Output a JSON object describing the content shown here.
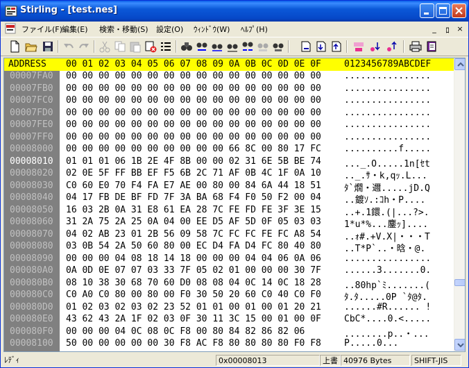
{
  "window": {
    "title": "Stirling - [test.nes]",
    "controls": {
      "minimize": "minimize",
      "maximize": "maximize",
      "close": "close"
    }
  },
  "menubar": {
    "items": [
      "ファイル(F)",
      "編集(E)",
      "検索・移動(S)",
      "設定(O)",
      "ｳｨﾝﾄﾞｳ(W)",
      "ﾍﾙﾌﾟ(H)"
    ],
    "mdi": [
      "_",
      "ﾛ",
      "×"
    ]
  },
  "toolbar": {
    "icons": [
      "new-file-icon",
      "open-folder-icon",
      "save-icon",
      "undo-icon",
      "redo-icon",
      "cut-icon",
      "copy-icon",
      "paste-icon",
      "delete-icon",
      "insert-list-icon",
      "find-icon",
      "find-next-icon",
      "find-prev-icon",
      "find-all-icon",
      "replace-icon",
      "jump-icon",
      "goto-icon",
      "bookmark-set-icon",
      "bookmark-next-icon",
      "bookmark-prev-icon",
      "mark-icon",
      "mark-next-icon",
      "mark-prev-icon",
      "print-icon",
      "print-preview-icon"
    ]
  },
  "editor": {
    "header": {
      "address": "ADDRESS",
      "columns": "00 01 02 03 04 05 06 07 08 09 0A 0B 0C 0D 0E 0F",
      "ascii": "0123456789ABCDEF"
    },
    "rows": [
      {
        "addr": "00007FA0",
        "hex": "00 00 00 00 00 00 00 00 00 00 00 00 00 00 00 00",
        "ascii": "................"
      },
      {
        "addr": "00007FB0",
        "hex": "00 00 00 00 00 00 00 00 00 00 00 00 00 00 00 00",
        "ascii": "................"
      },
      {
        "addr": "00007FC0",
        "hex": "00 00 00 00 00 00 00 00 00 00 00 00 00 00 00 00",
        "ascii": "................"
      },
      {
        "addr": "00007FD0",
        "hex": "00 00 00 00 00 00 00 00 00 00 00 00 00 00 00 00",
        "ascii": "................"
      },
      {
        "addr": "00007FE0",
        "hex": "00 00 00 00 00 00 00 00 00 00 00 00 00 00 00 00",
        "ascii": "................"
      },
      {
        "addr": "00007FF0",
        "hex": "00 00 00 00 00 00 00 00 00 00 00 00 00 00 00 00",
        "ascii": "................"
      },
      {
        "addr": "00008000",
        "hex": "00 00 00 00 00 00 00 00 00 00 66 8C 00 80 17 FC",
        "ascii": "..........f....."
      },
      {
        "addr": "00008010",
        "hex": "01 01 01 06 1B 2E 4F 8B 00 00 02 31 6E 5B BE 74",
        "ascii": "..._.O.....1n[ｾt"
      },
      {
        "addr": "00008020",
        "hex": "02 0E 5F FF BB EF F5 6B 2C 71 AF 0B 4C 1F 0A 10",
        "ascii": ".._.ｻ・k,qｯ.L..."
      },
      {
        "addr": "00008030",
        "hex": "C0 60 E0 70 F4 FA E7 AE 00 80 00 84 6A 44 18 51",
        "ascii": "ﾀ`燗・邇.....jD.Q"
      },
      {
        "addr": "00008040",
        "hex": "04 17 FB DE BF FD 7F 3A BA 68 F4 F0 50 F2 00 04",
        "ascii": "..鍍ｿ.:ｺh・P...."
      },
      {
        "addr": "00008050",
        "hex": "16 03 2B 0A 31 E8 61 EA 28 7C FE FD FE 3F 3E 15",
        "ascii": "..+.1鐶.(|...?>."
      },
      {
        "addr": "00008060",
        "hex": "31 2A 75 2A 25 0A 04 00 EE D5 AF 5D 0F 05 03 03",
        "ascii": "1*u*%...鏖ｯ]...."
      },
      {
        "addr": "00008070",
        "hex": "04 02 AB 23 01 2B 56 09 58 7C FC FC FE FC A8 54",
        "ascii": "..ｫ#.+V.X|・・・T"
      },
      {
        "addr": "00008080",
        "hex": "03 0B 54 2A 50 60 80 00 EC D4 FA D4 FC 80 40 80",
        "ascii": "..T*P`..・晗・@."
      },
      {
        "addr": "00008090",
        "hex": "00 00 00 04 08 18 14 18 00 00 00 04 04 06 0A 06",
        "ascii": "................"
      },
      {
        "addr": "000080A0",
        "hex": "0A 0D 0E 07 07 03 33 7F 05 02 01 00 00 00 30 7F",
        "ascii": "......3.......0."
      },
      {
        "addr": "000080B0",
        "hex": "08 10 38 30 68 70 60 D0 08 08 04 0C 14 0C 18 28",
        "ascii": "..80hp`ﾐ.......("
      },
      {
        "addr": "000080C0",
        "hex": "C0 A0 C0 80 00 80 00 F0 30 50 20 60 C0 40 C0 F0",
        "ascii": "ﾀ.ﾀ.....0P `ﾀ@ﾀ."
      },
      {
        "addr": "000080D0",
        "hex": "01 02 03 02 03 02 23 52 01 01 00 01 00 01 20 21",
        "ascii": "......#R...... !"
      },
      {
        "addr": "000080E0",
        "hex": "43 62 43 2A 1F 02 03 0F 30 11 3C 15 00 01 00 0F",
        "ascii": "CbC*....0.<....."
      },
      {
        "addr": "000080F0",
        "hex": "00 00 00 04 0C 08 0C F8 00 80 84 82 86 82 06",
        "ascii": "........p..・..."
      },
      {
        "addr": "00008100",
        "hex": "50 00 00 00 00 00 30 F8 AC F8 80 80 80 80 F0 F8",
        "ascii": "P.....0..."
      }
    ],
    "cursor_row_addr": "00008010"
  },
  "statusbar": {
    "ready": "ﾚﾃﾞｨ",
    "offset": "0x00008013",
    "mode": "上書",
    "size": "40976 Bytes",
    "encoding": "SHIFT-JIS"
  },
  "colors": {
    "header_bg": "#ffff00",
    "address_bg": "#808080",
    "address_fg": "#c0c0c0",
    "titlebar": "#0b58d8"
  }
}
